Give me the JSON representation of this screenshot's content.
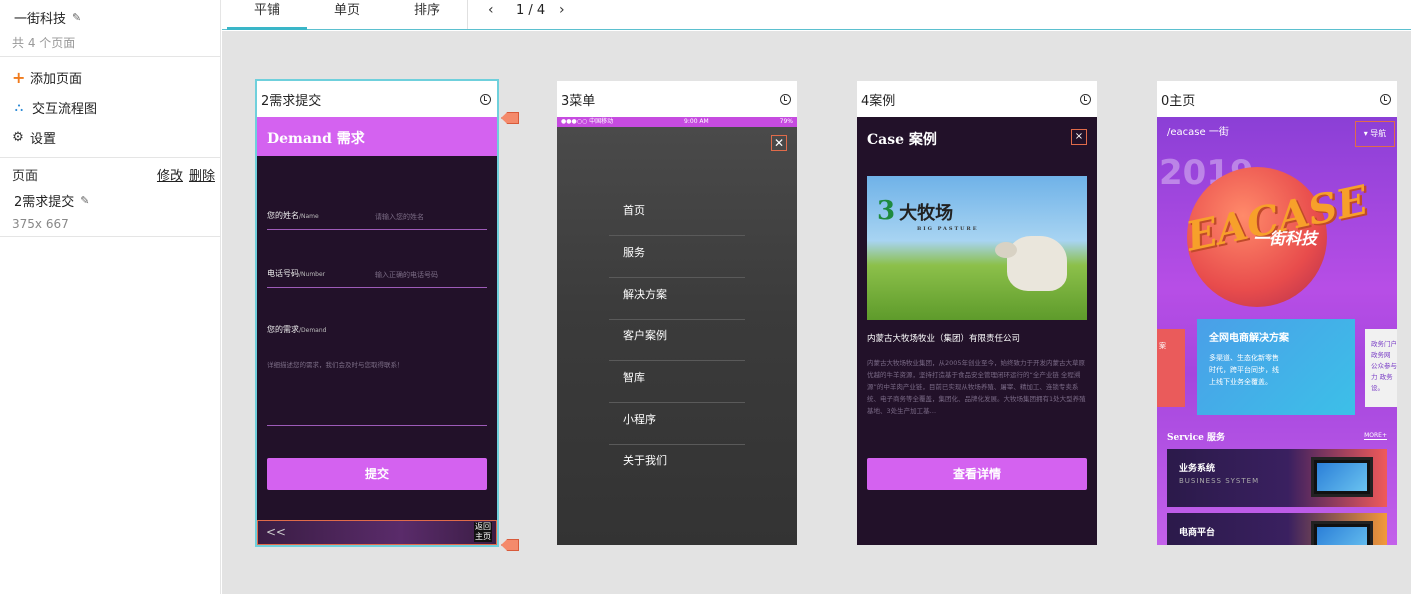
{
  "sidebar": {
    "project_title": "一街科技",
    "page_count": "共 4 个页面",
    "menu": [
      {
        "label": "添加页面"
      },
      {
        "label": "交互流程图"
      },
      {
        "label": "设置"
      }
    ],
    "pages_label": "页面",
    "edit_label": "修改",
    "delete_label": "删除",
    "current_page": "2需求提交",
    "current_size": "375x 667"
  },
  "toolbar": {
    "tabs": [
      {
        "label": "平铺",
        "active": true
      },
      {
        "label": "单页",
        "active": false
      },
      {
        "label": "排序",
        "active": false
      }
    ],
    "pager": "1 / 4"
  },
  "cards": [
    {
      "title": "2需求提交",
      "header": "Demand 需求",
      "fields": [
        {
          "label": "您的姓名",
          "sub": "/Name",
          "placeholder": "请输入您的姓名"
        },
        {
          "label": "电话号码",
          "sub": "/Number",
          "placeholder": "输入正确的电话号码"
        },
        {
          "label": "您的需求",
          "sub": "/Demand",
          "placeholder": ""
        }
      ],
      "demand_placeholder": "详细描述您的需求，我们会及时与您取得联系！",
      "submit": "提交",
      "footer_back": "< <",
      "footer_home": "返回主页"
    },
    {
      "title": "3菜单",
      "status_left": "●●●○○ 中国移动",
      "status_time": "9:00 AM",
      "status_right": "79%",
      "close": "✕",
      "menu": [
        "首页",
        "服务",
        "解决方案",
        "客户案例",
        "智库",
        "小程序",
        "关于我们"
      ]
    },
    {
      "title": "4案例",
      "header": "Case 案例",
      "close": "×",
      "logo_text": "大牧场",
      "logo_sub": "BIG PASTURE",
      "company": "内蒙古大牧场牧业（集团）有限责任公司",
      "desc": "内蒙古大牧场牧业集团，从2005年创业至今，始终致力于开发内蒙古大草原优越的牛羊资源，坚持打造基于食品安全管理闭环运行的“全产业链 全程溯源”的中羊肉产业链，目前已实现从牧场养殖、屠宰、精加工、连锁专卖系统、电子商务等全覆盖，集团化、品牌化发展。大牧场集团拥有1处大型养殖基地、3处生产加工基…",
      "button": "查看详情"
    },
    {
      "title": "0主页",
      "brand": "/eacase 一街",
      "nav": "▾ 导航",
      "year": "2019",
      "logo_big": "EACASE",
      "slogan": "一街科技",
      "side_left": "案",
      "solution_title": "全网电商解决方案",
      "solution_desc": "多渠道、生态化新零售时代，跨平台同步，线上线下业务全覆盖。",
      "side_right": "政务门户 政务网 公众参与 力 政务 设。",
      "service_title": "Service 服务",
      "service_more": "MORE+",
      "biz": [
        {
          "title": "业务系统",
          "sub": "BUSINESS SYSTEM"
        },
        {
          "title": "电商平台",
          "sub": ""
        }
      ]
    }
  ]
}
